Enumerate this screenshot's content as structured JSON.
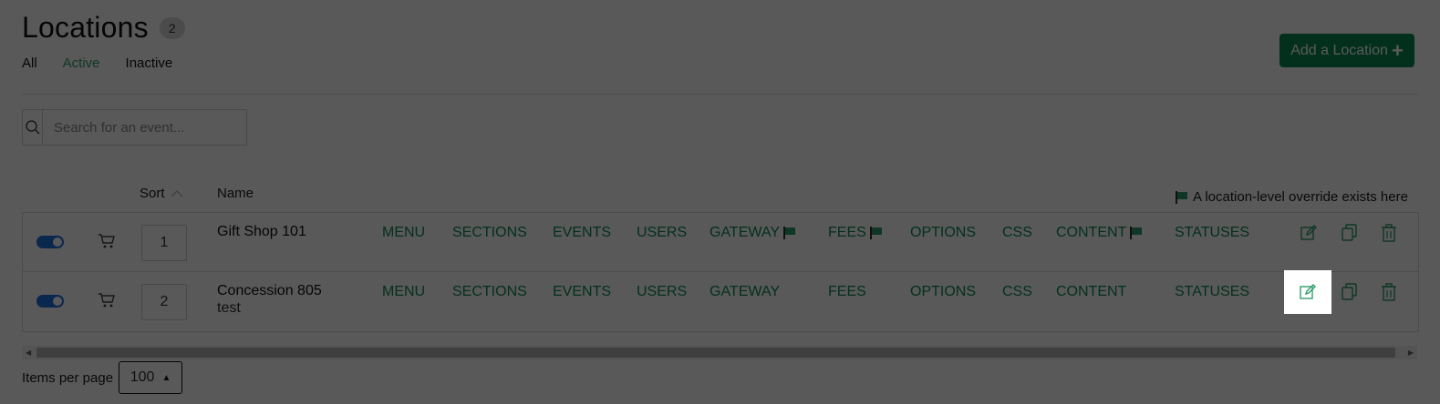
{
  "header": {
    "title": "Locations",
    "count": "2"
  },
  "filters": [
    {
      "label": "All",
      "active": false
    },
    {
      "label": "Active",
      "active": true
    },
    {
      "label": "Inactive",
      "active": false
    }
  ],
  "add_button": {
    "label": "Add a Location",
    "icon": "plus-icon"
  },
  "search": {
    "placeholder": "Search for an event..."
  },
  "table": {
    "columns": {
      "sort": "Sort",
      "name": "Name"
    },
    "legend": "A location-level override exists here",
    "links": [
      "MENU",
      "SECTIONS",
      "EVENTS",
      "USERS",
      "GATEWAY",
      "FEES",
      "OPTIONS",
      "CSS",
      "CONTENT",
      "STATUSES"
    ],
    "rows": [
      {
        "sort": "1",
        "name": "Gift Shop 101",
        "subtitle": "",
        "flags": [
          "GATEWAY",
          "FEES",
          "CONTENT"
        ],
        "enabled": true
      },
      {
        "sort": "2",
        "name": "Concession 805",
        "subtitle": "test",
        "flags": [],
        "enabled": true
      }
    ]
  },
  "pagination": {
    "label": "Items per page",
    "value": "100"
  },
  "colors": {
    "accent": "#0b8a55",
    "toggle": "#1f6fe0",
    "link": "#0b8a55"
  }
}
